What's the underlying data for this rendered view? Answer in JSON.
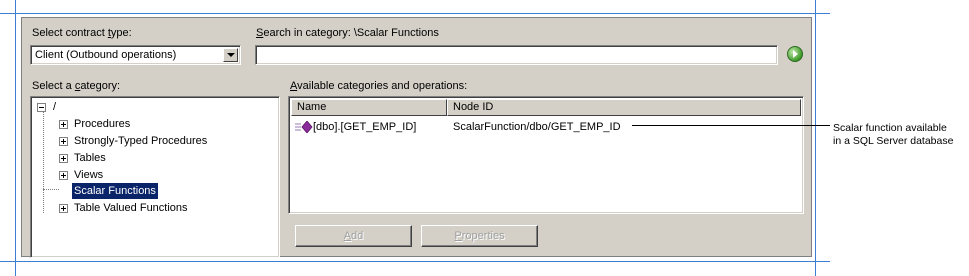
{
  "contract_type": {
    "label_prefix": "Select contract ",
    "label_accel": "t",
    "label_suffix": "ype:",
    "value": "Client (Outbound operations)"
  },
  "search": {
    "label_prefix": "",
    "label_accel": "S",
    "label_suffix": "earch in category: \\Scalar Functions",
    "value": ""
  },
  "category": {
    "label_prefix": "Select a ",
    "label_accel": "c",
    "label_suffix": "ategory:",
    "root": "/",
    "items": [
      "Procedures",
      "Strongly-Typed Procedures",
      "Tables",
      "Views",
      "Scalar Functions",
      "Table Valued Functions"
    ],
    "selected": "Scalar Functions"
  },
  "operations": {
    "label_prefix": "",
    "label_accel": "A",
    "label_suffix": "vailable categories and operations:",
    "columns": [
      "Name",
      "Node ID"
    ],
    "rows": [
      {
        "name": "[dbo].[GET_EMP_ID]",
        "node_id": "ScalarFunction/dbo/GET_EMP_ID"
      }
    ]
  },
  "buttons": {
    "add": {
      "accel": "A",
      "rest": "dd",
      "enabled": false
    },
    "properties": {
      "accel": "P",
      "rest": "roperties",
      "enabled": false
    }
  },
  "callout": {
    "line1": "Scalar function available",
    "line2": "in a SQL Server database"
  },
  "icons": {
    "go": "go-arrow-icon",
    "operation": "scalar-function-icon",
    "dropdown": "chevron-down-icon"
  }
}
